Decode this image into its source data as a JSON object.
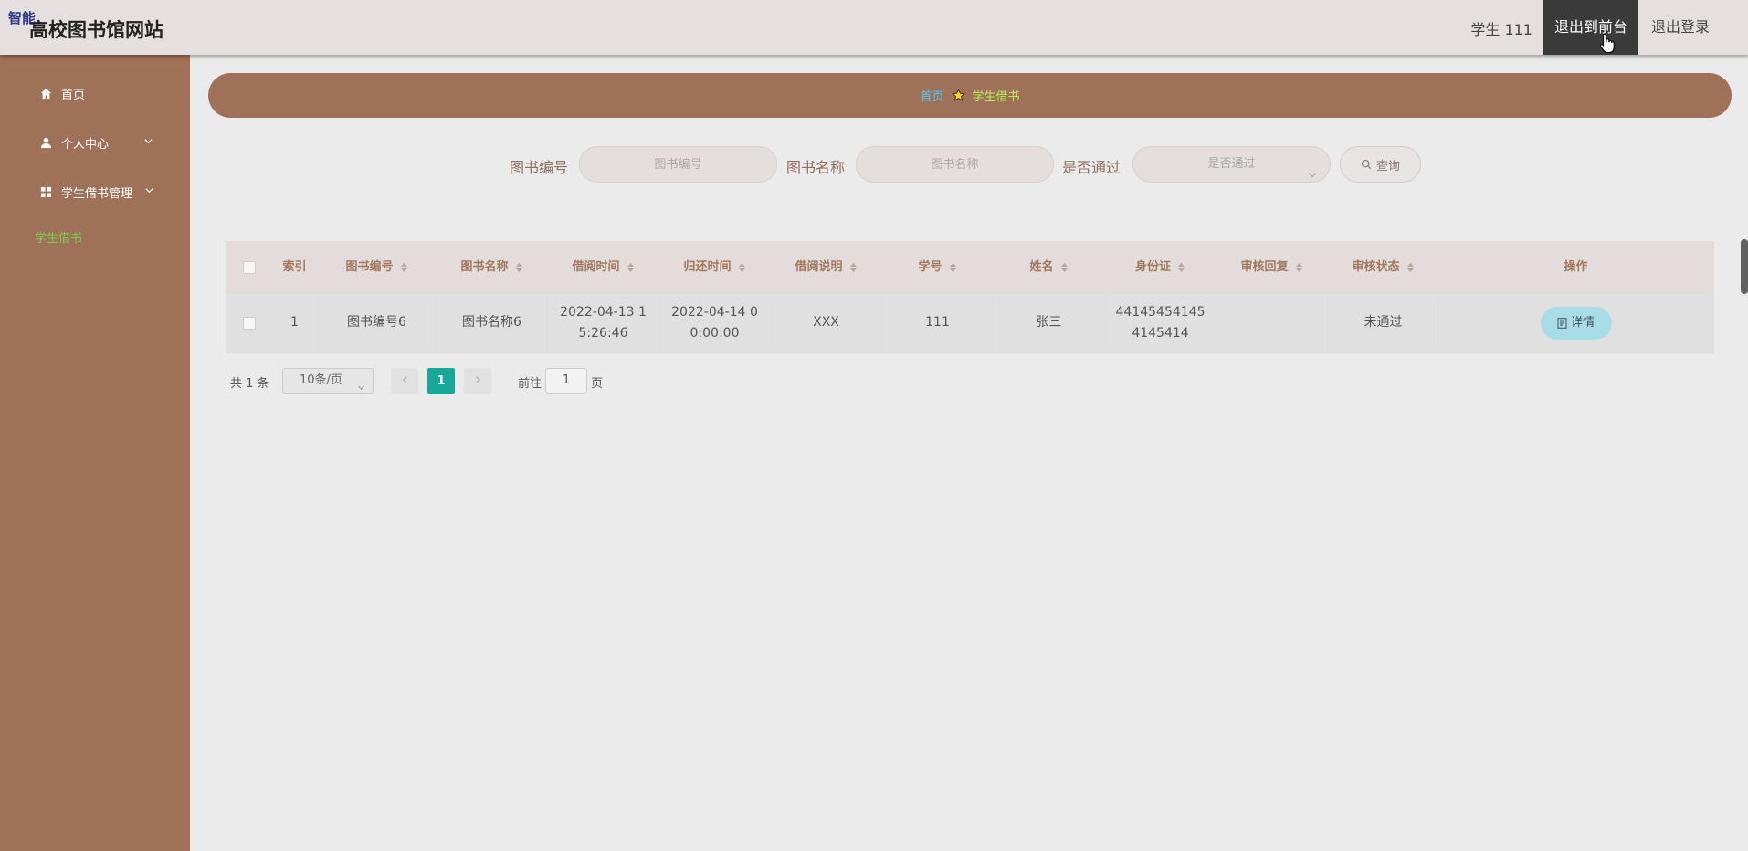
{
  "header": {
    "tag": "智能",
    "title": "高校图书馆网站",
    "user": "学生 111",
    "front_button": "退出到前台",
    "logout_button": "退出登录"
  },
  "sidebar": {
    "items": [
      {
        "label": "首页",
        "icon": "home-icon"
      },
      {
        "label": "个人中心",
        "icon": "user-icon"
      },
      {
        "label": "学生借书管理",
        "icon": "grid-icon"
      }
    ],
    "sub_item": "学生借书"
  },
  "breadcrumb": {
    "home": "首页",
    "current": "学生借书"
  },
  "search": {
    "book_no_label": "图书编号",
    "book_no_placeholder": "图书编号",
    "book_name_label": "图书名称",
    "book_name_placeholder": "图书名称",
    "passed_label": "是否通过",
    "passed_placeholder": "是否通过",
    "query_button": "查询"
  },
  "table": {
    "headers": [
      "索引",
      "图书编号",
      "图书名称",
      "借阅时间",
      "归还时间",
      "借阅说明",
      "学号",
      "姓名",
      "身份证",
      "审核回复",
      "审核状态",
      "操作"
    ],
    "rows": [
      {
        "index": "1",
        "book_no": "图书编号6",
        "book_name": "图书名称6",
        "borrow_time": "2022-04-13 15:26:46",
        "return_time": "2022-04-14 00:00:00",
        "note": "XXX",
        "student_no": "111",
        "name": "张三",
        "id_card": "441454541454145414",
        "reply": "",
        "status": "未通过",
        "action": "详情"
      }
    ]
  },
  "pagination": {
    "total": "共 1 条",
    "page_size": "10条/页",
    "current_page": "1",
    "goto_label": "前往",
    "goto_value": "1",
    "page_label": "页"
  },
  "colors": {
    "sidebar": "#9f7158",
    "active_sub": "#7bd14e",
    "page_active": "#17a89a",
    "detail_button": "#a8dde8"
  }
}
